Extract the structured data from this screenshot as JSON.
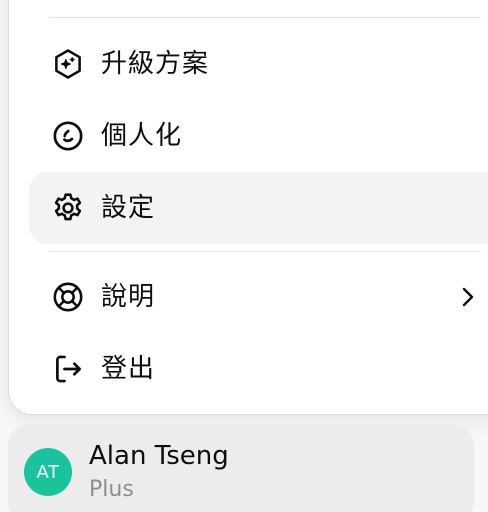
{
  "menu": {
    "items": [
      {
        "id": "upgrade",
        "label": "升級方案",
        "icon": "sparkle-hexagon-icon"
      },
      {
        "id": "personalize",
        "label": "個人化",
        "icon": "smiley-circle-icon"
      },
      {
        "id": "settings",
        "label": "設定",
        "icon": "gear-icon",
        "active": true
      },
      {
        "id": "help",
        "label": "說明",
        "icon": "lifebuoy-icon",
        "has_submenu": true
      },
      {
        "id": "logout",
        "label": "登出",
        "icon": "logout-icon"
      }
    ]
  },
  "profile": {
    "initials": "AT",
    "name": "Alan Tseng",
    "plan": "Plus",
    "avatar_color": "#19c39c"
  },
  "colors": {
    "text": "#0d0d0d",
    "muted": "#8e8e8e",
    "active_bg": "#f3f3f3",
    "panel_bg": "#ffffff",
    "card_bg": "#ececec"
  }
}
